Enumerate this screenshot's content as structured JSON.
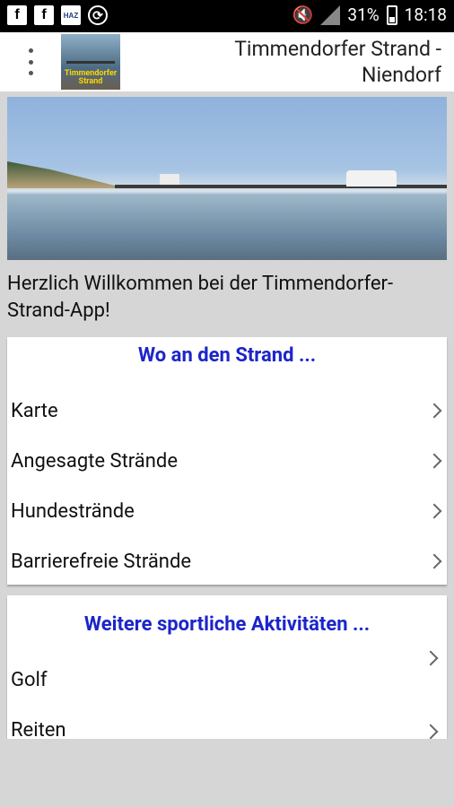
{
  "statusbar": {
    "battery": "31%",
    "time": "18:18",
    "icons": [
      "facebook-icon",
      "facebook-icon",
      "haz-app-icon",
      "sync-icon",
      "mute-icon",
      "signal-icon",
      "battery-icon"
    ],
    "haz_label": "HAZ"
  },
  "appbar": {
    "title": "Timmendorfer Strand - Niendorf",
    "logo_text": "Timmendorfer Strand"
  },
  "welcome": "Herzlich Willkommen bei der Timmendorfer-Strand-App!",
  "section1": {
    "title": "Wo an den Strand ...",
    "items": [
      "Karte",
      "Angesagte Strände",
      "Hundestrände",
      "Barrierefreie Strände"
    ]
  },
  "section2": {
    "title": "Weitere sportliche Aktivitäten ...",
    "items": [
      "Golf",
      "Reiten"
    ]
  },
  "colors": {
    "section_title": "#1c25c9",
    "background": "#d6d6d6"
  }
}
